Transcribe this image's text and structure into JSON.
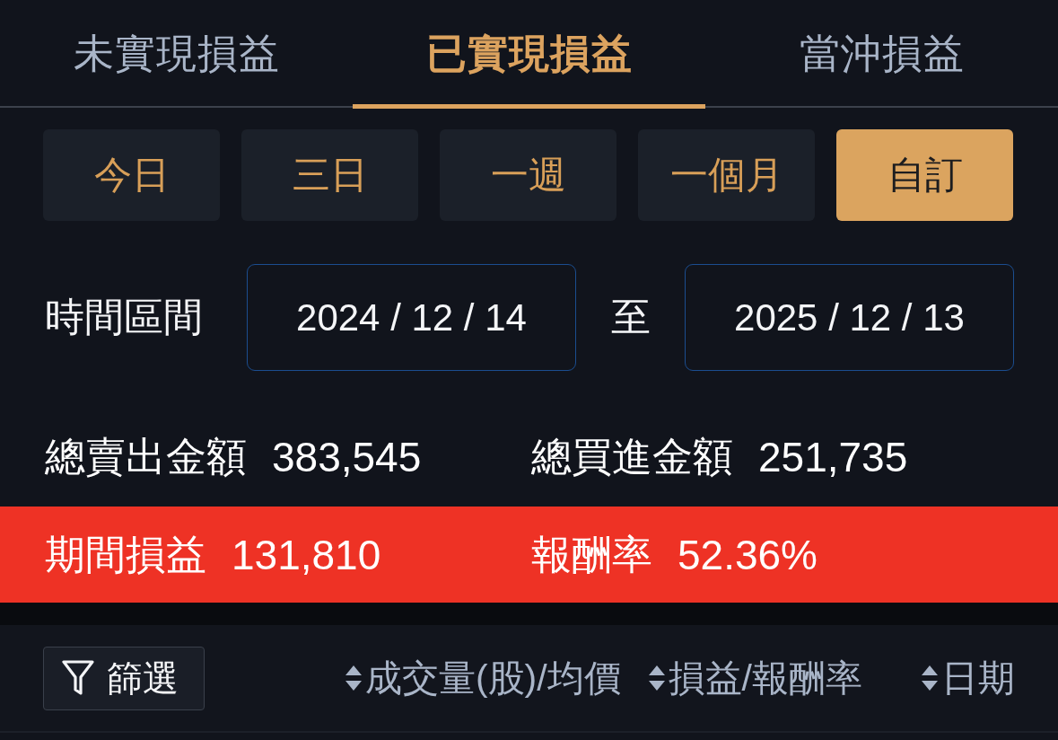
{
  "tabs": [
    {
      "label": "未實現損益",
      "selected": false
    },
    {
      "label": "已實現損益",
      "selected": true
    },
    {
      "label": "當沖損益",
      "selected": false
    }
  ],
  "periods": [
    {
      "label": "今日",
      "selected": false
    },
    {
      "label": "三日",
      "selected": false
    },
    {
      "label": "一週",
      "selected": false
    },
    {
      "label": "一個月",
      "selected": false
    },
    {
      "label": "自訂",
      "selected": true
    }
  ],
  "date_range": {
    "label": "時間區間",
    "start": "2024 / 12 / 14",
    "separator": "至",
    "end": "2025 / 12 / 13"
  },
  "totals": [
    {
      "label": "總賣出金額",
      "value": "383,545"
    },
    {
      "label": "總買進金額",
      "value": "251,735"
    }
  ],
  "summary": [
    {
      "label": "期間損益",
      "value": "131,810"
    },
    {
      "label": "報酬率",
      "value": "52.36%"
    }
  ],
  "list_header": {
    "filter": {
      "label": "篩選"
    },
    "sort_columns": [
      {
        "label": "成交量(股)/均價"
      },
      {
        "label": "損益/報酬率"
      },
      {
        "label": "日期"
      }
    ]
  }
}
